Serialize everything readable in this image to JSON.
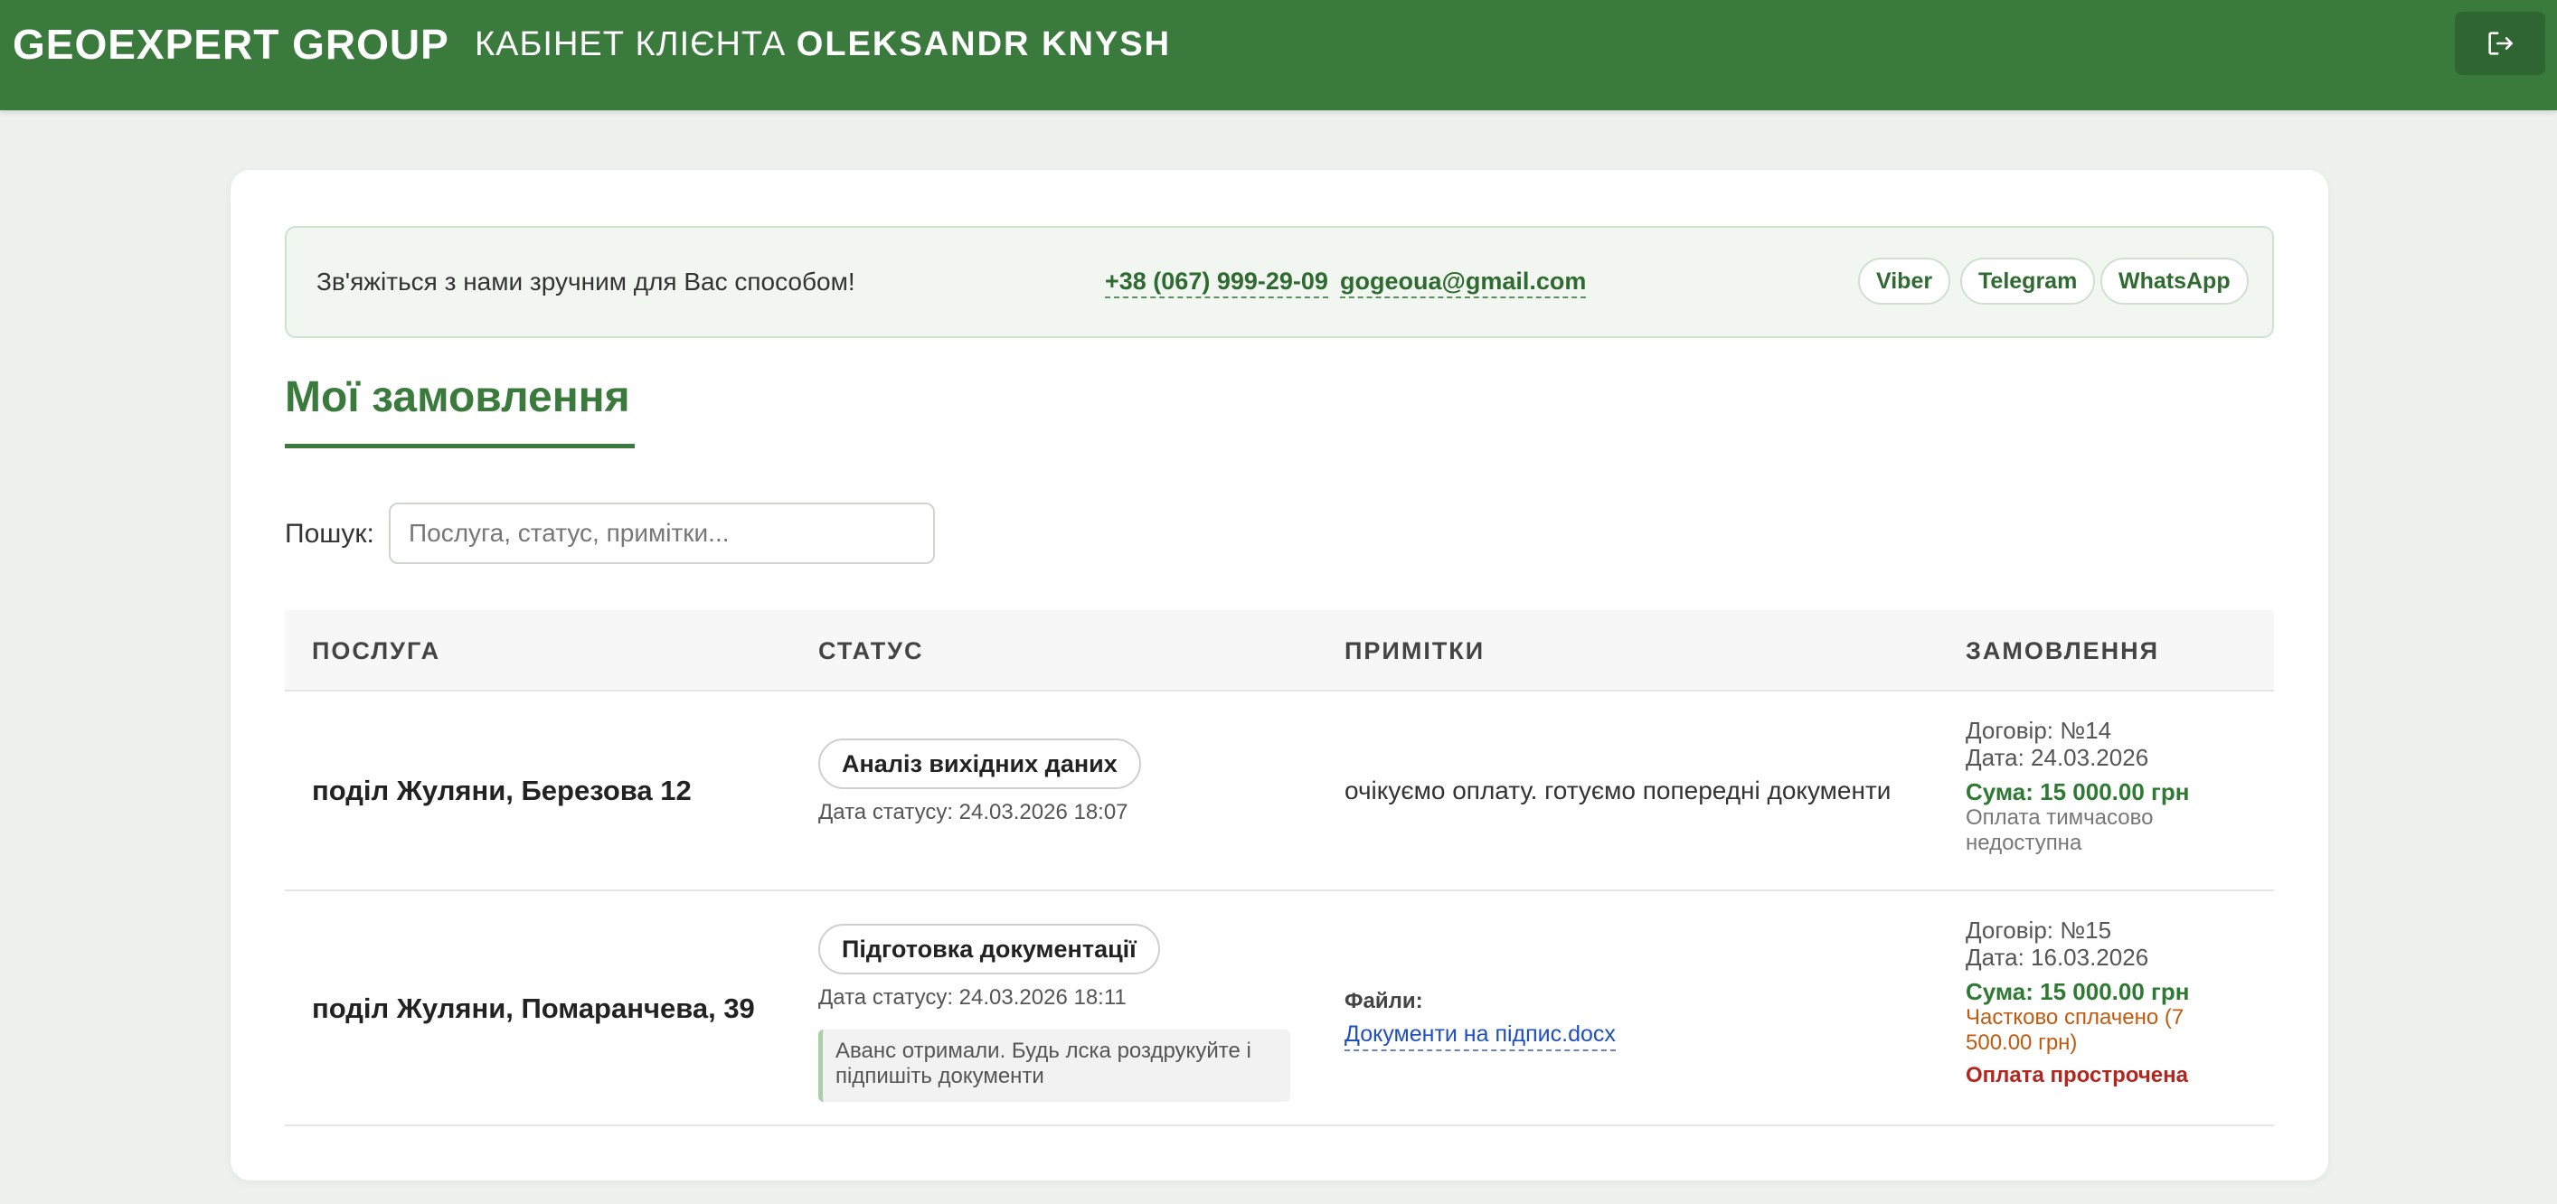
{
  "header": {
    "brand": "GEOEXPERT GROUP",
    "cabinet_label": "КАБІНЕТ КЛІЄНТА",
    "user_name": "OLEKSANDR KNYSH",
    "logout_icon": "logout-icon"
  },
  "contact": {
    "text": "Зв'яжіться з нами зручним для Вас способом!",
    "phone": "+38 (067) 999-29-09",
    "email": "gogeoua@gmail.com",
    "messengers": [
      "Viber",
      "Telegram",
      "WhatsApp"
    ]
  },
  "page_title": "Мої замовлення",
  "search": {
    "label": "Пошук:",
    "placeholder": "Послуга, статус, примітки...",
    "value": ""
  },
  "table": {
    "headers": [
      "ПОСЛУГА",
      "СТАТУС",
      "ПРИМІТКИ",
      "ЗАМОВЛЕННЯ"
    ],
    "rows": [
      {
        "service": "поділ Жуляни, Березова 12",
        "status": "Аналіз вихідних даних",
        "status_date": "Дата статусу: 24.03.2026 18:07",
        "notes": "очікуємо оплату. готуємо попередні документи",
        "contract": "Договір: №14",
        "date": "Дата: 24.03.2026",
        "sum": "Сума: 15 000.00 грн",
        "payment_note": "Оплата тимчасово недоступна"
      },
      {
        "service": "поділ Жуляни, Помаранчева, 39",
        "status": "Підготовка документації",
        "status_date": "Дата статусу: 24.03.2026 18:11",
        "status_comment": "Аванс отримали. Будь лска роздрукуйте і підпишіть документи",
        "files_label": "Файли:",
        "file_name": "Документи на підпис.docx",
        "contract": "Договір: №15",
        "date": "Дата: 16.03.2026",
        "sum": "Сума: 15 000.00 грн",
        "payment_note": "Частково сплачено (7 500.00 грн)",
        "overdue": "Оплата прострочена"
      }
    ]
  },
  "colors": {
    "brand_green": "#3b7a3d",
    "link_blue": "#1f4fbf",
    "warning_orange": "#c25a0e",
    "danger_red": "#b3261e"
  }
}
